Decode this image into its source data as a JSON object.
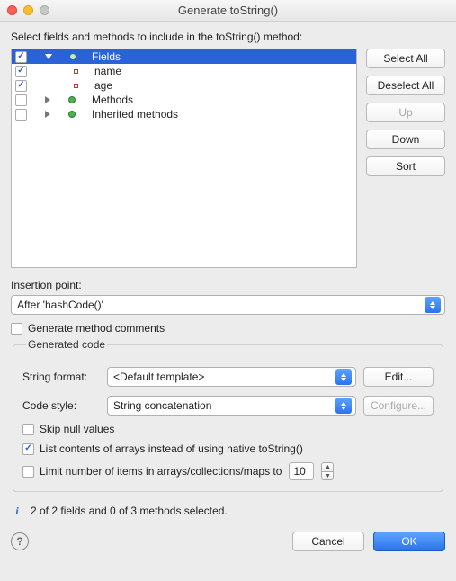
{
  "window": {
    "title": "Generate toString()"
  },
  "prompt": "Select fields and methods to include in the toString() method:",
  "tree": {
    "fields_label": "Fields",
    "name_label": "name",
    "age_label": "age",
    "methods_label": "Methods",
    "inherited_label": "Inherited methods"
  },
  "side": {
    "select_all": "Select All",
    "deselect_all": "Deselect All",
    "up": "Up",
    "down": "Down",
    "sort": "Sort"
  },
  "insertion": {
    "label": "Insertion point:",
    "value": "After 'hashCode()'"
  },
  "gencomments": {
    "label": "Generate method comments"
  },
  "group": {
    "legend": "Generated code"
  },
  "format": {
    "label": "String format:",
    "value": "<Default template>",
    "edit": "Edit..."
  },
  "codestyle": {
    "label": "Code style:",
    "value": "String concatenation",
    "configure": "Configure..."
  },
  "opts": {
    "skipnull": "Skip null values",
    "listarr": "List contents of arrays instead of using native toString()",
    "limit": "Limit number of items in arrays/collections/maps to",
    "limit_value": "10"
  },
  "status": "2 of 2 fields and 0 of 3 methods selected.",
  "footer": {
    "cancel": "Cancel",
    "ok": "OK"
  }
}
